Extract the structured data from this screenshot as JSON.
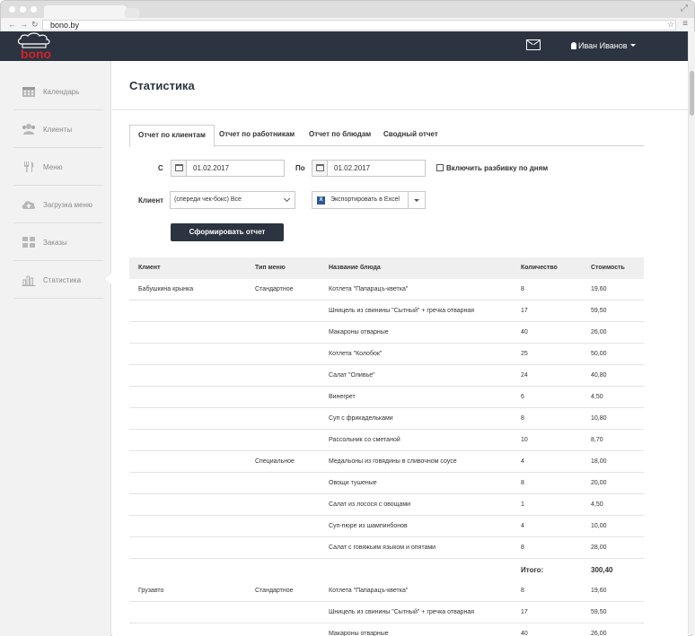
{
  "browser": {
    "url": "bono.by"
  },
  "header": {
    "logo_text": "bono",
    "user_name": "Иван Иванов"
  },
  "sidebar": {
    "items": [
      {
        "label": "Календарь",
        "icon": "calendar-icon"
      },
      {
        "label": "Клиенты",
        "icon": "users-icon"
      },
      {
        "label": "Меню",
        "icon": "cutlery-icon"
      },
      {
        "label": "Загрузка меню",
        "icon": "cloud-upload-icon"
      },
      {
        "label": "Заказы",
        "icon": "grid-icon"
      },
      {
        "label": "Статистика",
        "icon": "bar-chart-icon",
        "active": true
      }
    ]
  },
  "page": {
    "title": "Статистика",
    "tabs": [
      "Отчет по клиентам",
      "Отчет по работникам",
      "Отчет по блюдам",
      "Сводный отчет"
    ],
    "active_tab": 0
  },
  "filters": {
    "from_label": "С",
    "from_value": "01.02.2017",
    "to_label": "По",
    "to_value": "01.02.2017",
    "daily_split_label": "Включить разбивку по дням",
    "client_label": "Клиент",
    "client_value": "(спереди чек-бокс) Все",
    "export_label": "Экспортировать в Excel",
    "generate_label": "Сформировать отчет"
  },
  "table": {
    "headers": [
      "Клиент",
      "Тип меню",
      "Название блюда",
      "Количество",
      "Стоимость"
    ],
    "rows": [
      [
        "Бабушкина крынка",
        "Стандартное",
        "Котлета \"Папарацъ-кветка\"",
        "8",
        "19,60"
      ],
      [
        "",
        "",
        "Шницель из свинины \"Сытный\" + гречка отварная",
        "17",
        "59,50"
      ],
      [
        "",
        "",
        "Макароны отварные",
        "40",
        "26,00"
      ],
      [
        "",
        "",
        "Котлета \"Колобок\"",
        "25",
        "50,00"
      ],
      [
        "",
        "",
        "Салат \"Оливье\"",
        "24",
        "40,80"
      ],
      [
        "",
        "",
        "Винегрет",
        "6",
        "4,50"
      ],
      [
        "",
        "",
        "Суп с фрикадельками",
        "8",
        "10,80"
      ],
      [
        "",
        "",
        "Рассольник со сметаной",
        "10",
        "8,70"
      ],
      [
        "",
        "Специальное",
        "Медальоны из говядины в сливочном соусе",
        "4",
        "18,00"
      ],
      [
        "",
        "",
        "Овощи тушеные",
        "8",
        "20,00"
      ],
      [
        "",
        "",
        "Салат из лосося с овощами",
        "1",
        "4,50"
      ],
      [
        "",
        "",
        "Суп-пюре из шампинбонов",
        "4",
        "10,00"
      ],
      [
        "",
        "",
        "Салат с говяжьим языком и опятами",
        "8",
        "28,00"
      ],
      [
        "",
        "",
        "",
        "Итого:",
        "300,40"
      ],
      [
        "Грузавто",
        "Стандартное",
        "Котлета \"Папарацъ-кветка\"",
        "8",
        "19,60"
      ],
      [
        "",
        "",
        "Шницель из свинины \"Сытный\" + гречка отварная",
        "17",
        "59,50"
      ],
      [
        "",
        "",
        "Макароны отварные",
        "40",
        "26,00"
      ]
    ]
  }
}
